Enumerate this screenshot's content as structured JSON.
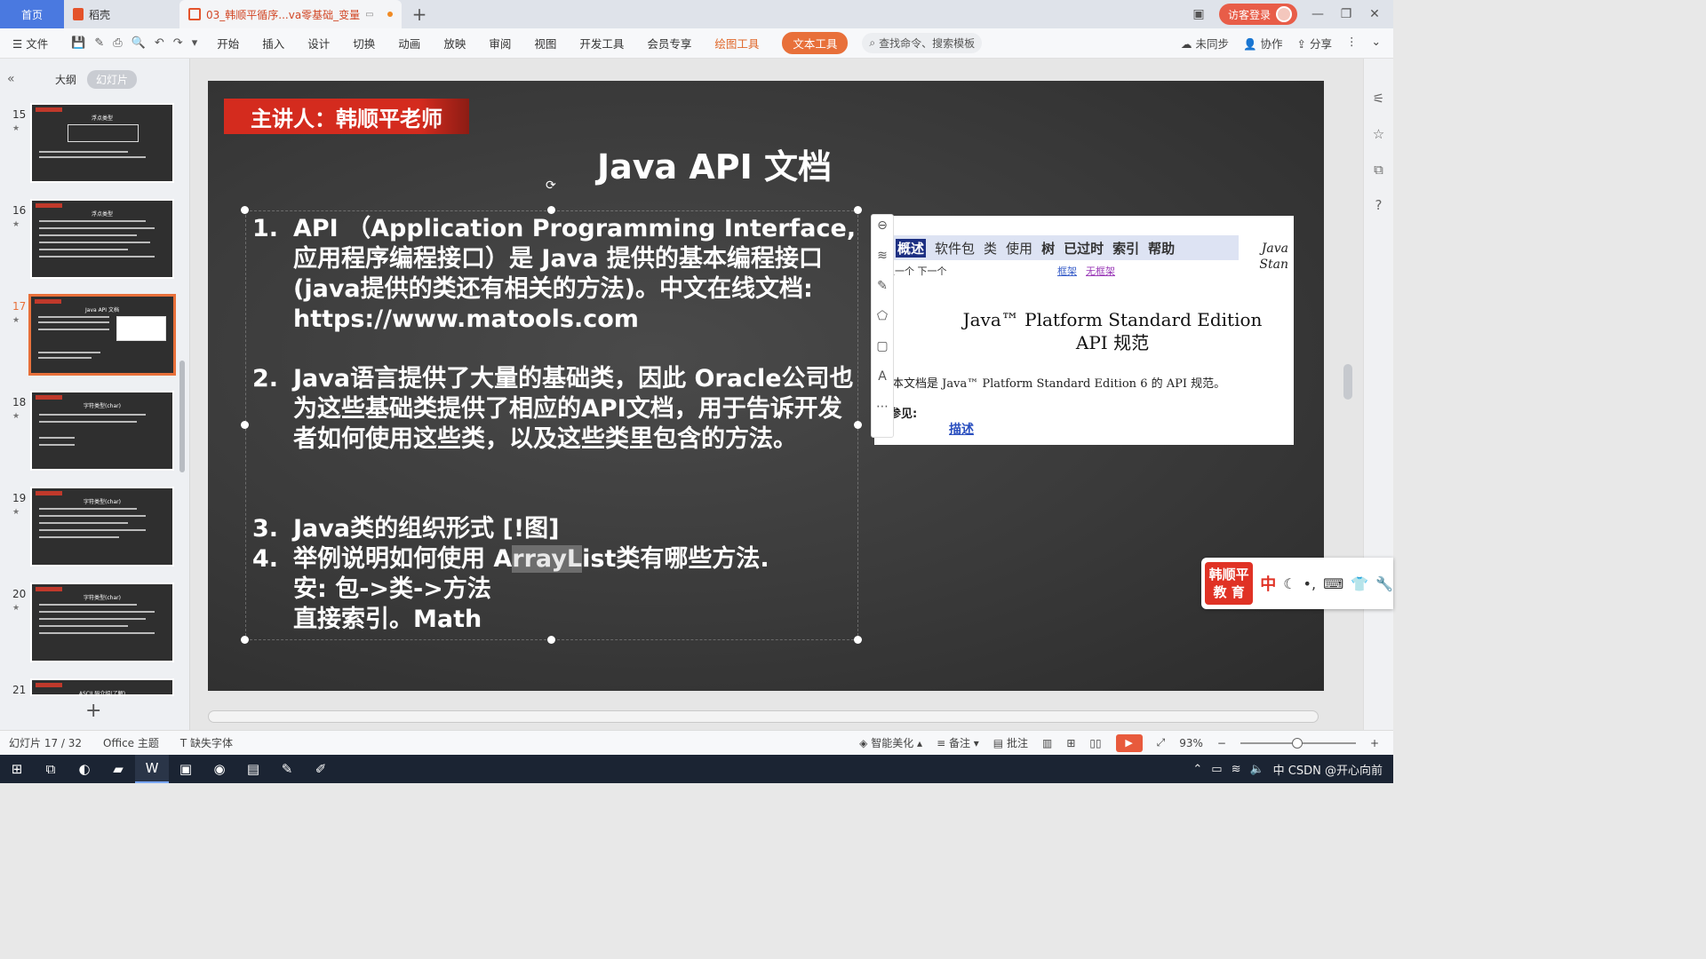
{
  "tabs": {
    "home": "首页",
    "daoke": "稻壳",
    "doc": "03_韩顺平循序...va零基础_变量",
    "login": "访客登录"
  },
  "menu": {
    "file": "文件",
    "items": [
      "开始",
      "插入",
      "设计",
      "切换",
      "动画",
      "放映",
      "审阅",
      "视图",
      "开发工具",
      "会员专享"
    ],
    "drawing_tools": "绘图工具",
    "text_tools": "文本工具",
    "search_placeholder": "查找命令、搜索模板",
    "sync": "未同步",
    "collab": "协作",
    "share": "分享"
  },
  "left_panel": {
    "outline_tab": "大纲",
    "slides_tab": "幻灯片",
    "slides": [
      {
        "num": "15",
        "title": "浮点类型"
      },
      {
        "num": "16",
        "title": "浮点类型"
      },
      {
        "num": "17",
        "title": "Java API 文档"
      },
      {
        "num": "18",
        "title": "字符类型(char)"
      },
      {
        "num": "19",
        "title": "字符类型(char)"
      },
      {
        "num": "20",
        "title": "字符类型(char)"
      },
      {
        "num": "21",
        "title": "ASCII 码介绍(了解)"
      }
    ],
    "add_slide": "+"
  },
  "slide": {
    "speaker": "主讲人：韩顺平老师",
    "title": "Java API 文档",
    "items": [
      {
        "num": "1.",
        "text": "API （Application Programming Interface,应用程序编程接口）是 Java 提供的基本编程接口(java提供的类还有相关的方法)。中文在线文档: https://www.matools.com"
      },
      {
        "num": "2.",
        "text": "Java语言提供了大量的基础类，因此 Oracle公司也为这些基础类提供了相应的API文档，用于告诉开发者如何使用这些类，以及这些类里包含的方法。"
      },
      {
        "num": "3.",
        "text": "Java类的组织形式 [!图]"
      },
      {
        "num": "4.",
        "pre": "举例说明如何使用 A",
        "sel": "rrayL",
        "post": "ist类有哪些方法."
      }
    ],
    "line_a": "安: 包->类->方法",
    "line_b": "直接索引。Math",
    "embed": {
      "nav": [
        "概述",
        "软件包",
        "类",
        "使用",
        "树",
        "已过时",
        "索引",
        "帮助"
      ],
      "prev_next": "上一个  下一个",
      "frames": "框架",
      "no_frames": "无框架",
      "java_corner_1": "Java",
      "java_corner_2": "Stan",
      "heading_1": "Java™ Platform Standard Edition",
      "heading_2": "API 规范",
      "desc": "本文档是 Java™ Platform Standard Edition 6 的 API 规范。",
      "see_also": "请参见:",
      "link": "描述"
    }
  },
  "ime": {
    "badge_1": "韩顺平",
    "badge_2": "教 育",
    "lang": "中"
  },
  "status": {
    "slide_count": "幻灯片 17 / 32",
    "theme": "Office 主题",
    "missing_font": "缺失字体",
    "beautify": "智能美化",
    "notes": "备注",
    "comments": "批注",
    "zoom": "93%"
  },
  "taskbar": {
    "tray_text": "中 CSDN @开心向前"
  }
}
